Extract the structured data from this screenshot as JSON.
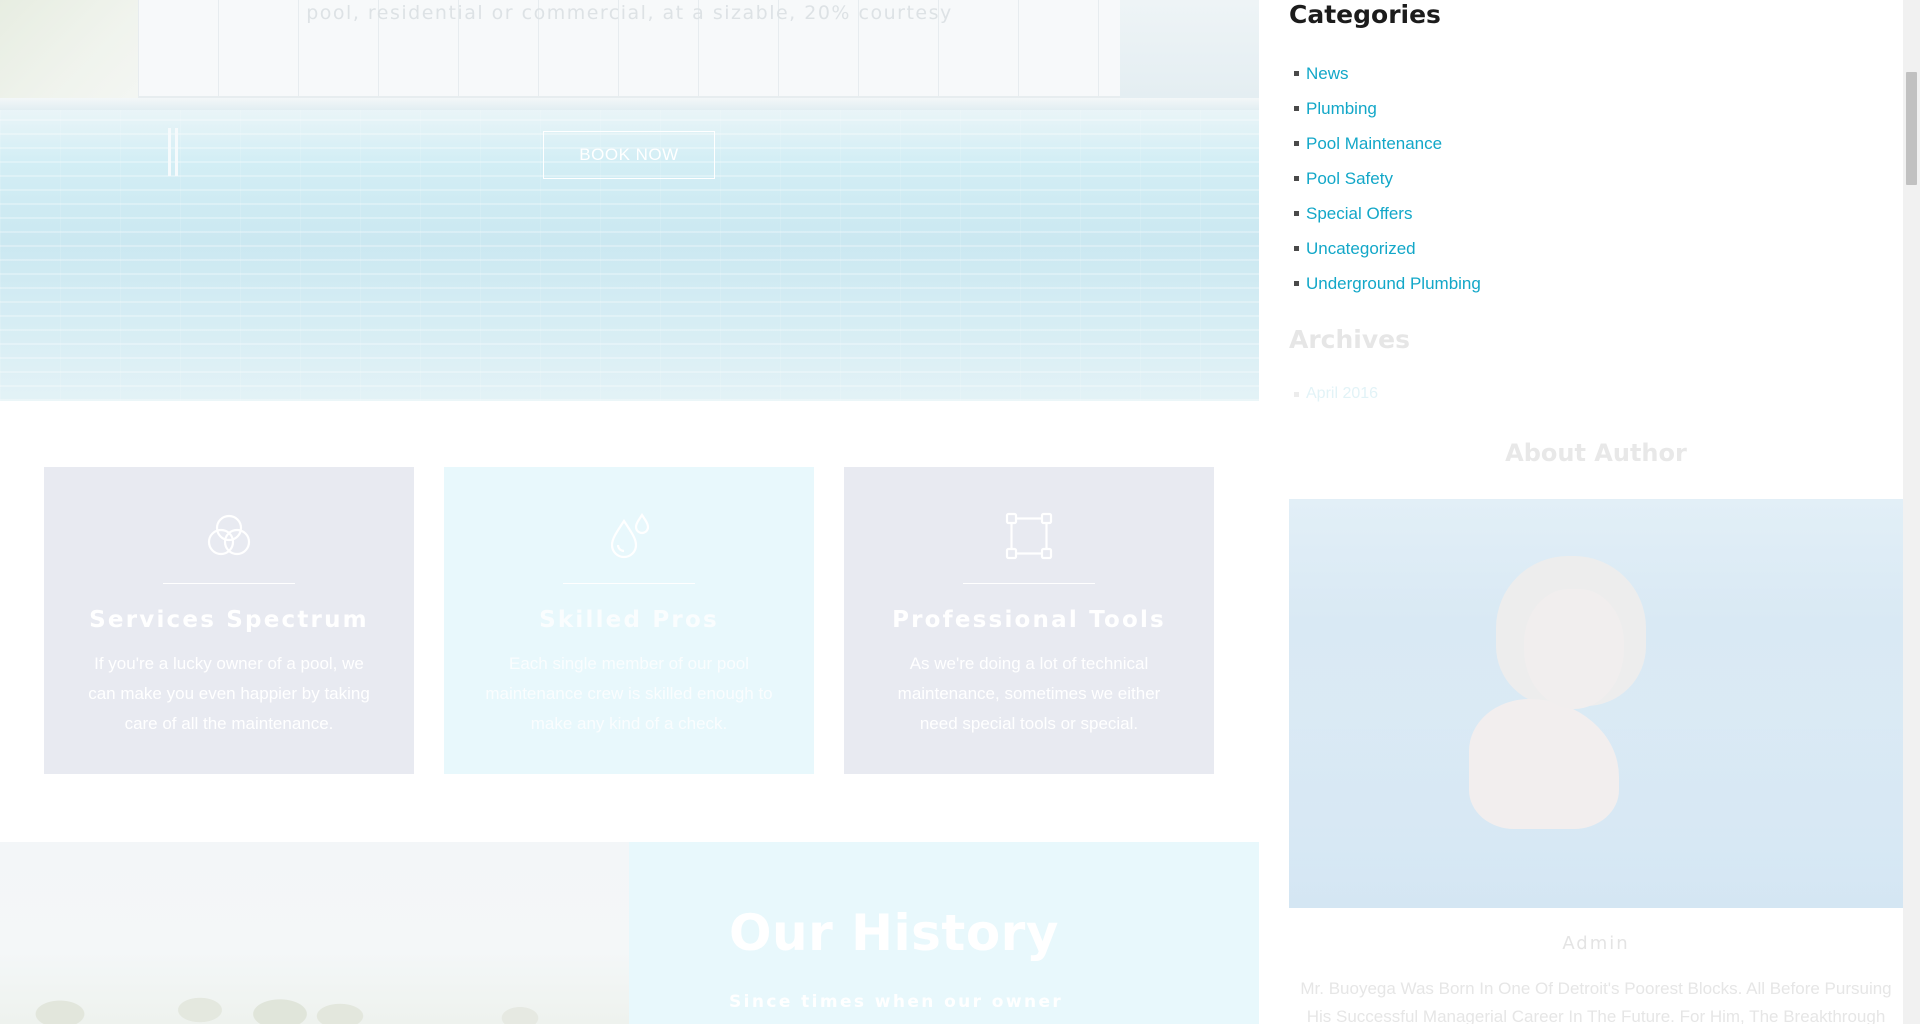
{
  "hero": {
    "tagline": "pool, residential or commercial, at a sizable, 20% courtesy",
    "book_label": "BOOK NOW"
  },
  "features": [
    {
      "icon": "overlapping-circles-icon",
      "title": "Services Spectrum",
      "desc": "If you're a lucky owner of a pool, we can make you even happier by taking care of all the maintenance."
    },
    {
      "icon": "water-drops-icon",
      "title": "Skilled Pros",
      "desc": "Each single member of our pool maintenance crew is skilled enough to make any kind of a check."
    },
    {
      "icon": "vector-square-icon",
      "title": "Professional Tools",
      "desc": "As we're doing a lot of technical maintenance, sometimes we either need special tools or special."
    }
  ],
  "history": {
    "title": "Our History",
    "subtitle": "Since times when our owner"
  },
  "sidebar": {
    "categories_title": "Categories",
    "categories": [
      {
        "label": "News"
      },
      {
        "label": "Plumbing"
      },
      {
        "label": "Pool Maintenance"
      },
      {
        "label": "Pool Safety"
      },
      {
        "label": "Special Offers"
      },
      {
        "label": "Uncategorized"
      },
      {
        "label": "Underground Plumbing"
      }
    ],
    "archives_title": "Archives",
    "archives": [
      {
        "label": "April 2016"
      }
    ],
    "about_title": "About Author",
    "author_name": "Admin",
    "author_bio": "Mr. Buoyega Was Born In One Of Detroit's Poorest Blocks. All Before Pursuing His Successful Managerial Career In The Future. For Him, The Breakthrough"
  },
  "colors": {
    "link": "#12a7c8",
    "card_gray": "#e8eaf1",
    "card_cyan": "#e8f8fc"
  }
}
